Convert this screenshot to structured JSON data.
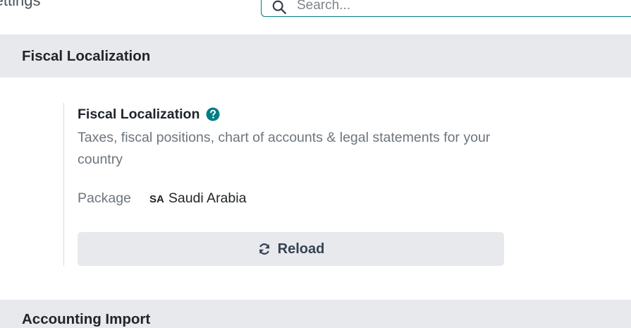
{
  "header": {
    "title": "Settings",
    "search_placeholder": "Search..."
  },
  "sections": [
    {
      "title": "Fiscal Localization"
    },
    {
      "title": "Accounting Import"
    }
  ],
  "setting": {
    "title": "Fiscal Localization",
    "description": "Taxes, fiscal positions, chart of accounts & legal statements for your country",
    "package_label": "Package",
    "package_code": "SA",
    "package_value": "Saudi Arabia",
    "reload_label": "Reload"
  },
  "colors": {
    "accent": "#017e84",
    "section_bg": "#e8e9ed",
    "button_bg": "#e7e9ed",
    "muted_text": "#6c757d"
  },
  "icons": [
    "search-icon",
    "help-icon",
    "reload-icon"
  ]
}
